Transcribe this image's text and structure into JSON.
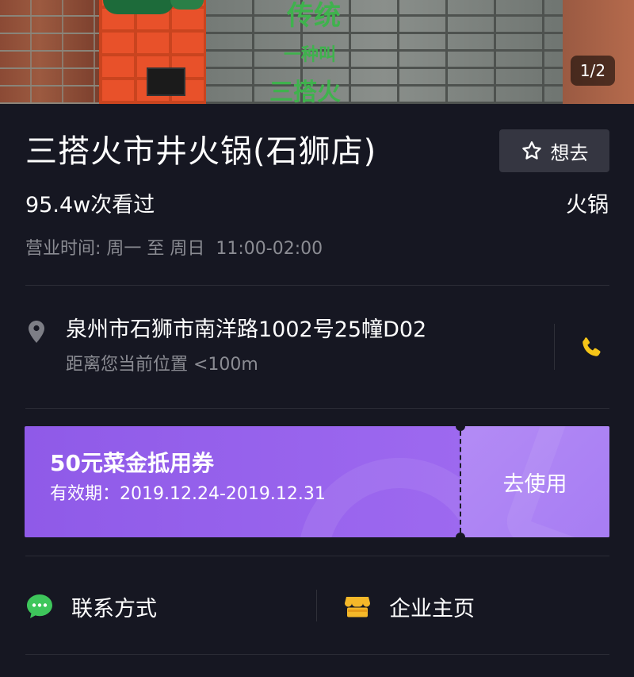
{
  "hero": {
    "sign_line1": "传统",
    "sign_line2": "一种叫",
    "sign_line3": "三搭火",
    "counter": "1/2"
  },
  "store": {
    "name": "三搭火市井火锅(石狮店)",
    "want_label": "想去",
    "views": "95.4w次看过",
    "category": "火锅",
    "hours": "营业时间: 周一 至 周日  11:00-02:00"
  },
  "location": {
    "address": "泉州市石狮市南洋路1002号25幢D02",
    "distance": "距离您当前位置 <100m"
  },
  "coupon": {
    "title": "50元菜金抵用券",
    "validity": "有效期：2019.12.24-2019.12.31",
    "use_label": "去使用"
  },
  "actions": {
    "contact_label": "联系方式",
    "homepage_label": "企业主页"
  },
  "colors": {
    "background": "#161722",
    "coupon_start": "#8f5ae8",
    "coupon_end": "#a26ef2",
    "phone_accent": "#f5c518",
    "chat_green": "#3ec65b",
    "shop_yellow": "#f5b829"
  },
  "icons": {
    "want": "star-outline-icon",
    "location": "map-pin-icon",
    "phone": "phone-icon",
    "contact": "chat-bubble-icon",
    "homepage": "shop-icon"
  }
}
